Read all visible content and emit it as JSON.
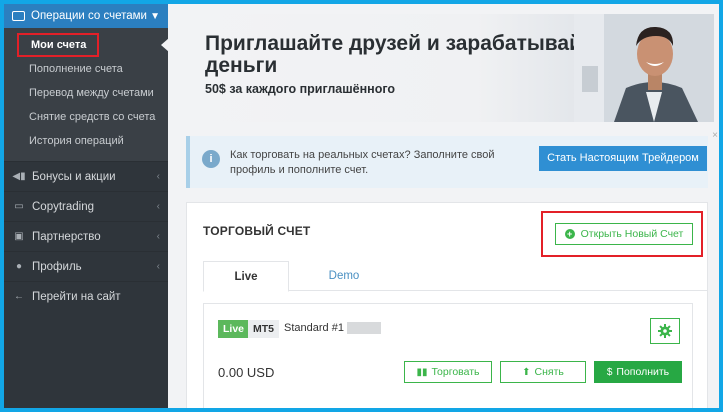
{
  "sidebar": {
    "header": {
      "label": "Операции со счетами"
    },
    "submenu": [
      {
        "label": "Мои счета",
        "active": true
      },
      {
        "label": "Пополнение счета"
      },
      {
        "label": "Перевод между счетами"
      },
      {
        "label": "Снятие средств со счета"
      },
      {
        "label": "История операций"
      }
    ],
    "items": [
      {
        "label": "Бонусы и акции",
        "icon": "megaphone-icon"
      },
      {
        "label": "Copytrading",
        "icon": "copy-icon"
      },
      {
        "label": "Партнерство",
        "icon": "briefcase-icon"
      },
      {
        "label": "Профиль",
        "icon": "user-icon"
      },
      {
        "label": "Перейти на сайт",
        "icon": "arrow-left-icon"
      }
    ]
  },
  "banner": {
    "title": "Приглашайте друзей и зарабатывайте деньги",
    "subtitle": "50$ за каждого приглашённого"
  },
  "info": {
    "text": "Как торговать на реальных счетах? Заполните свой профиль и пополните счет.",
    "cta": "Стать Настоящим Трейдером",
    "close": "×"
  },
  "account_card": {
    "title": "ТОРГОВЫЙ СЧЕТ",
    "open_button": "Открыть Новый Счет",
    "tabs": [
      {
        "label": "Live",
        "active": true
      },
      {
        "label": "Demo"
      }
    ],
    "account": {
      "status_badge": "Live",
      "platform_badge": "MT5",
      "name": "Standard #1",
      "balance": "0.00 USD",
      "buttons": {
        "trade": "Торговать",
        "withdraw": "Снять",
        "deposit": "Пополнить"
      }
    }
  },
  "colors": {
    "accent_blue": "#2f8fd3",
    "green": "#3bb54a",
    "highlight_red": "#e32028",
    "sidebar_bg": "#2f353b"
  }
}
